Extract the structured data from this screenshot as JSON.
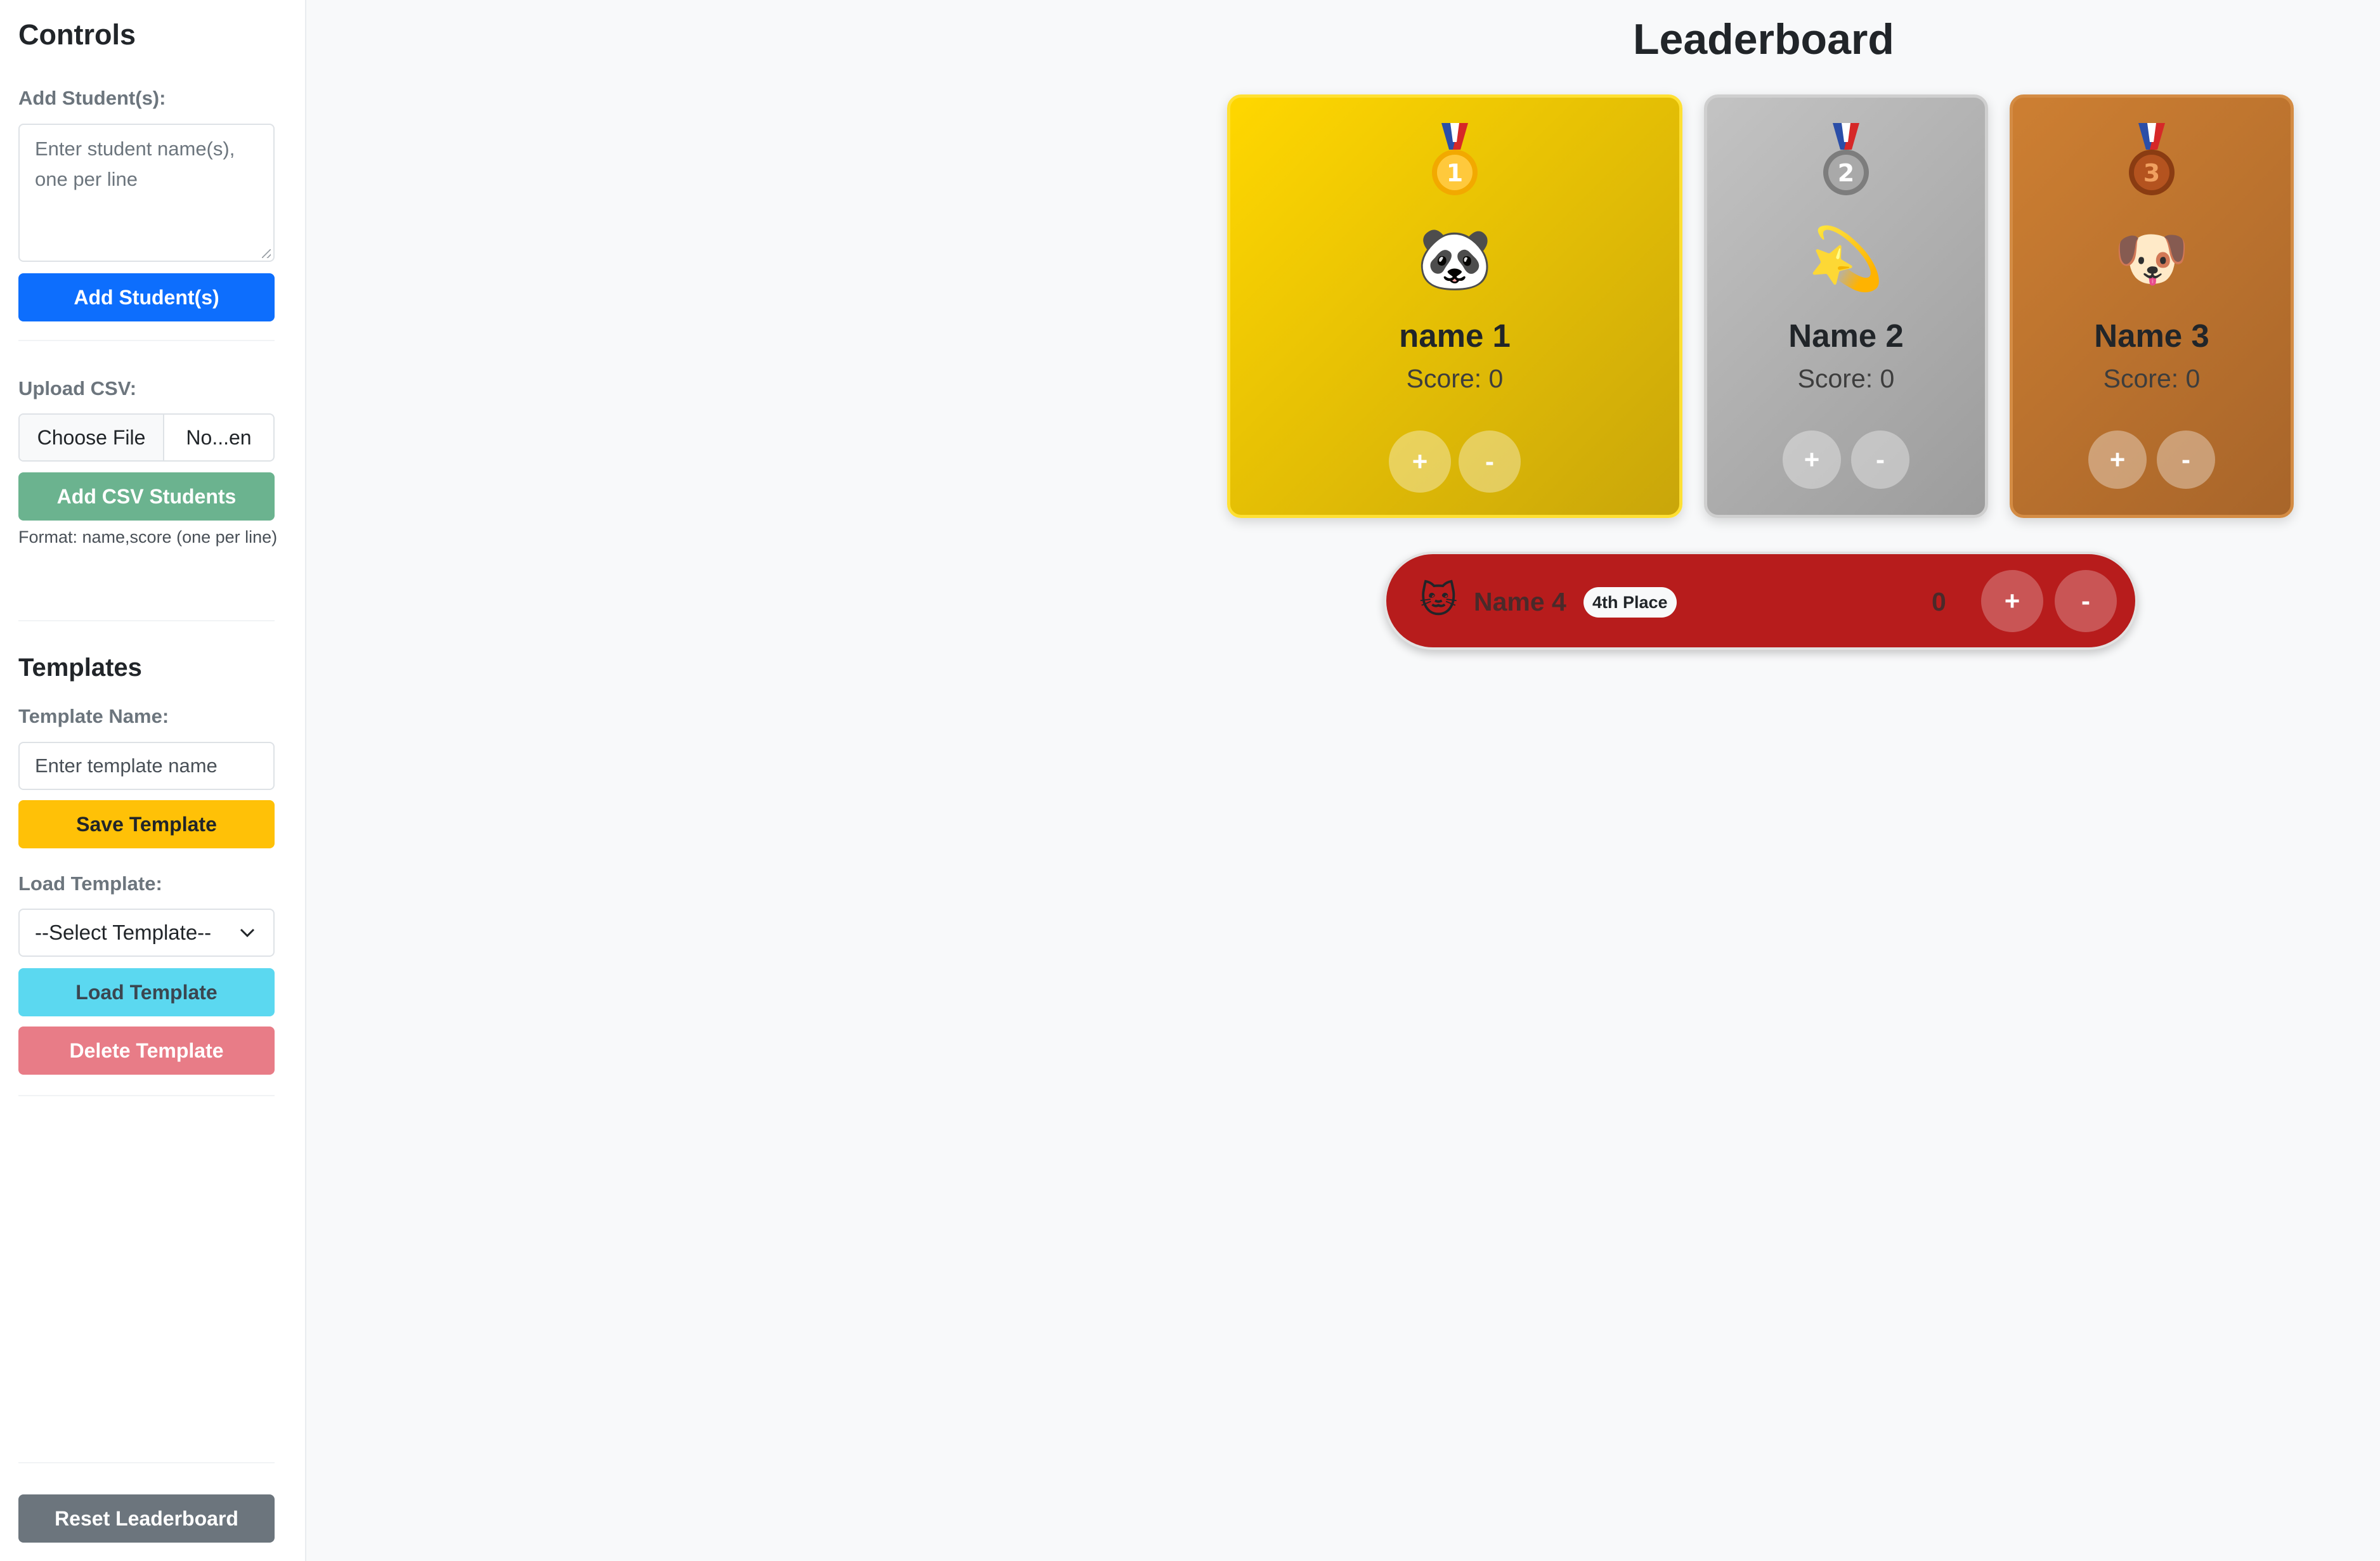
{
  "sidebar": {
    "title": "Controls",
    "add_students": {
      "label": "Add Student(s):",
      "placeholder": "Enter student name(s), one per line",
      "button": "Add Student(s)"
    },
    "upload_csv": {
      "label": "Upload CSV:",
      "choose_file": "Choose File",
      "file_name": "No...en",
      "button": "Add CSV Students",
      "help": "Format: name,score (one per line)"
    },
    "templates": {
      "title": "Templates",
      "name_label": "Template Name:",
      "name_placeholder": "Enter template name",
      "save_button": "Save Template",
      "load_label": "Load Template:",
      "select_value": "--Select Template--",
      "load_button": "Load Template",
      "delete_button": "Delete Template"
    },
    "reset_button": "Reset Leaderboard"
  },
  "leaderboard": {
    "title": "Leaderboard",
    "podium": [
      {
        "rank": "1",
        "medal": "gold-medal-icon",
        "avatar": "🐼",
        "avatar_name": "panda-icon",
        "name": "name 1",
        "score_label": "Score:",
        "score": "0",
        "plus": "+",
        "minus": "-"
      },
      {
        "rank": "2",
        "medal": "silver-medal-icon",
        "avatar": "💫",
        "avatar_name": "dizzy-star-icon",
        "name": "Name 2",
        "score_label": "Score:",
        "score": "0",
        "plus": "+",
        "minus": "-"
      },
      {
        "rank": "3",
        "medal": "bronze-medal-icon",
        "avatar": "🐶",
        "avatar_name": "dog-icon",
        "name": "Name 3",
        "score_label": "Score:",
        "score": "0",
        "plus": "+",
        "minus": "-"
      }
    ],
    "others": [
      {
        "avatar": "🐱",
        "avatar_name": "cat-icon",
        "name": "Name 4",
        "badge": "4th Place",
        "score": "0",
        "plus": "+",
        "minus": "-"
      }
    ]
  },
  "colors": {
    "primary": "#0d6efd",
    "success": "#6bb38f",
    "warning": "#ffc107",
    "info": "#5bd8f0",
    "danger": "#e87c87",
    "secondary": "#6c757d",
    "gold": "#ffd700",
    "silver": "#c0c0c0",
    "bronze": "#cd7f32",
    "fourth_row": "#b71c1c"
  }
}
